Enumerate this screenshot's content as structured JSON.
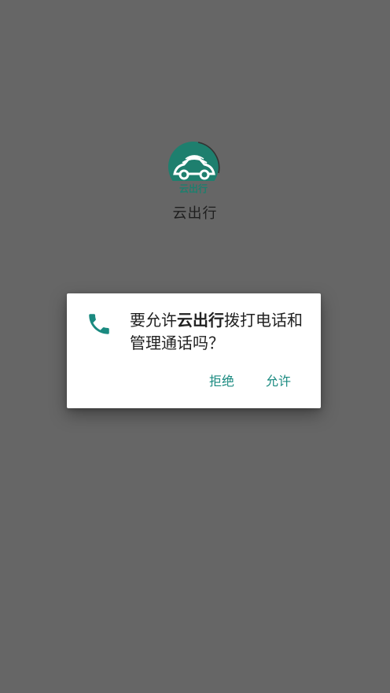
{
  "splash": {
    "logo_text": "云出行",
    "app_name": "云出行"
  },
  "permission_dialog": {
    "message_prefix": "要允许",
    "app_name": "云出行",
    "message_suffix": "拨打电话和管理通话吗？",
    "deny_label": "拒绝",
    "allow_label": "允许",
    "icon": "phone-icon"
  },
  "colors": {
    "background": "#666666",
    "accent": "#1a8a80",
    "logo": "#1e7f6e"
  }
}
